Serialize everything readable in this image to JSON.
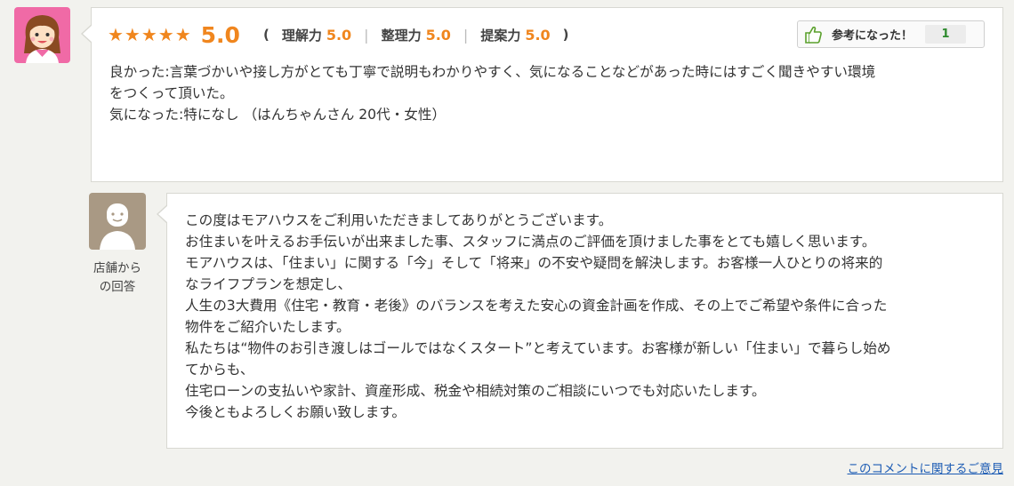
{
  "review": {
    "stars": "★★★★★",
    "overall_score": "5.0",
    "open_paren": "(",
    "close_paren": ")",
    "separator": "|",
    "sub_ratings": [
      {
        "label": "理解力",
        "value": "5.0"
      },
      {
        "label": "整理力",
        "value": "5.0"
      },
      {
        "label": "提案力",
        "value": "5.0"
      }
    ],
    "helpful": {
      "label": "参考になった！",
      "count": "1",
      "icon": "thumbs-up-hand-icon"
    },
    "lines": [
      "良かった:言葉づかいや接し方がとても丁寧で説明もわかりやすく、気になることなどがあった時にはすごく聞きやすい環境",
      "をつくって頂いた。",
      "気になった:特になし （はんちゃんさん 20代・女性）"
    ]
  },
  "shop_reply": {
    "caption_lines": [
      "店舗から",
      "の回答"
    ],
    "lines": [
      "この度はモアハウスをご利用いただきましてありがとうございます。",
      "お住まいを叶えるお手伝いが出来ました事、スタッフに満点のご評価を頂けました事をとても嬉しく思います。",
      "モアハウスは、「住まい」に関する「今」そして「将来」の不安や疑問を解決します。お客様一人ひとりの将来的",
      "なライフプランを想定し、",
      "人生の3大費用《住宅・教育・老後》のバランスを考えた安心の資金計画を作成、その上でご希望や条件に合った",
      "物件をご紹介いたします。",
      "私たちは“物件のお引き渡しはゴールではなくスタート”と考えています。お客様が新しい「住まい」で暮らし始め",
      "てからも、",
      "住宅ローンの支払いや家計、資産形成、税金や相続対策のご相談にいつでも対応いたします。",
      "今後ともよろしくお願い致します。"
    ]
  },
  "footer": {
    "inquiry_link": "このコメントに関するご意見"
  },
  "colors": {
    "accent": "#f0861e",
    "link": "#1d5cb4",
    "helpful_count": "#2d8a2d",
    "user_avatar_bg": "#f06aa6",
    "shop_avatar_bg": "#a99984"
  }
}
